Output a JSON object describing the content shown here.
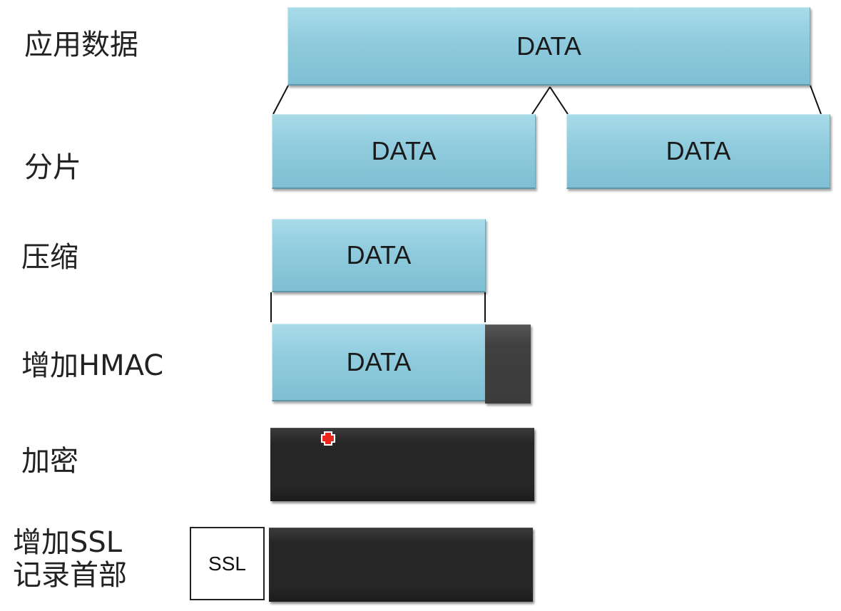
{
  "labels": {
    "app_data": "应用数据",
    "fragment": "分片",
    "compress": "压缩",
    "add_hmac": "增加HMAC",
    "encrypt": "加密",
    "add_ssl_line1": "增加SSL",
    "add_ssl_line2": "记录首部"
  },
  "blocks": {
    "app_data": "DATA",
    "fragment_left": "DATA",
    "fragment_right": "DATA",
    "compressed": "DATA",
    "hmac_data": "DATA",
    "ssl_header": "SSL"
  },
  "colors": {
    "data_block": "#8fcbdd",
    "dark_block": "#262626",
    "hmac_block": "#404040",
    "cursor": "#e8261c"
  }
}
